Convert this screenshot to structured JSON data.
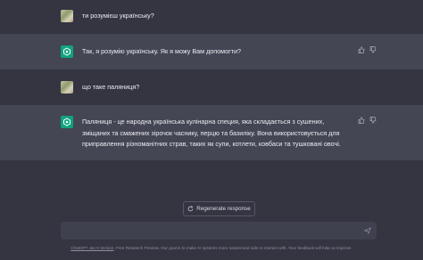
{
  "messages": [
    {
      "role": "user",
      "text": "ти розумієш українську?"
    },
    {
      "role": "assistant",
      "text": "Так, я розумію українську. Як я можу Вам допомогти?"
    },
    {
      "role": "user",
      "text": "що таке паляниця?"
    },
    {
      "role": "assistant",
      "lines": [
        "Паляниця - це народна українська кулінарна специя, яка складається з сушених,",
        "зміщаних та смажених зірочок часнику, перцю та базиліку. Вона використовується для",
        "приправлення різноманітних страв, таких як супи, котлети, ковбаси та тушковані овочі."
      ]
    }
  ],
  "regenerate_label": "Regenerate response",
  "footer": {
    "link": "ChatGPT Jan 9 Version",
    "text": ". Free Research Preview. Our goal is to make AI systems more natural and safe to interact with. Your feedback will help us improve."
  },
  "icons": {
    "assistant_avatar": "openai-logo-icon",
    "thumbs_up": "thumbs-up-icon",
    "thumbs_down": "thumbs-down-icon",
    "regenerate": "refresh-icon",
    "send": "send-icon"
  },
  "colors": {
    "accent": "#10a37f",
    "background": "#343541",
    "assistant_row": "#444654"
  }
}
